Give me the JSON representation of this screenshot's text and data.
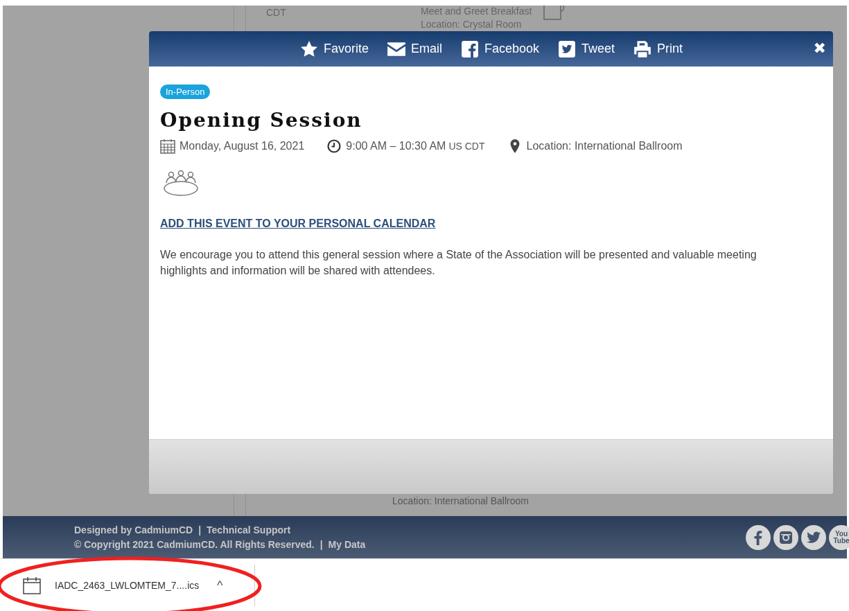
{
  "background_page": {
    "time_zone": "CDT",
    "session_title": "Meet and Greet Breakfast",
    "session_location": "Location: Crystal Room",
    "lower_location": "Location: International Ballroom"
  },
  "modal": {
    "actions": [
      {
        "kind": "favorite",
        "label": "Favorite"
      },
      {
        "kind": "email",
        "label": "Email"
      },
      {
        "kind": "facebook",
        "label": "Facebook"
      },
      {
        "kind": "twitter",
        "label": "Tweet"
      },
      {
        "kind": "print",
        "label": "Print"
      }
    ],
    "close": "✖",
    "badge": "In-Person",
    "title": "Opening Session",
    "date": "Monday, August 16, 2021",
    "time": "9:00 AM – 10:30 AM",
    "time_zone": "US CDT",
    "location": "Location: International Ballroom",
    "calendar_link": "ADD THIS EVENT TO YOUR PERSONAL CALENDAR",
    "description": "We encourage you to attend this general session where a State of the Association will be presented and valuable meeting highlights and information will be shared with attendees."
  },
  "footer": {
    "designed_by": "Designed by CadmiumCD",
    "separator_1": "|",
    "support_link": "Technical Support",
    "copyright": "© Copyright 2021 CadmiumCD. All Rights Reserved.",
    "separator_2": "|",
    "my_data_link": "My Data",
    "social": [
      {
        "kind": "facebook"
      },
      {
        "kind": "instagram"
      },
      {
        "kind": "twitter"
      },
      {
        "kind": "youtube",
        "label": "You Tube"
      }
    ]
  },
  "download_bar": {
    "file_name": "IADC_2463_LWLOMTEM_7....ics",
    "caret": "^"
  }
}
